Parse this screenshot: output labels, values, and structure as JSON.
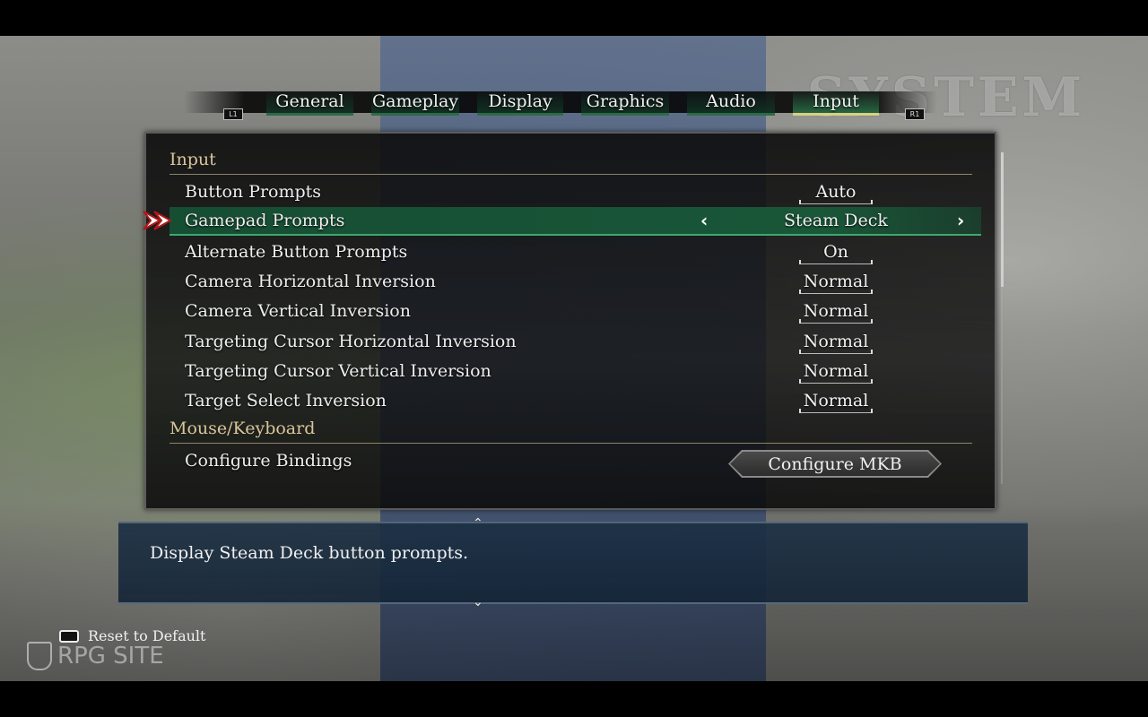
{
  "background": {
    "system_word": "SYSTEM",
    "watermark": "RPG SITE"
  },
  "tabs": [
    {
      "label": "General",
      "active": false
    },
    {
      "label": "Gameplay",
      "active": false
    },
    {
      "label": "Display",
      "active": false
    },
    {
      "label": "Graphics",
      "active": false
    },
    {
      "label": "Audio",
      "active": false
    },
    {
      "label": "Input",
      "active": true
    }
  ],
  "shoulder": {
    "left": "L1",
    "right": "R1"
  },
  "sections": {
    "input": "Input",
    "mouse_keyboard": "Mouse/Keyboard"
  },
  "settings": [
    {
      "label": "Button Prompts",
      "value": "Auto"
    },
    {
      "label": "Gamepad Prompts",
      "value": "Steam Deck",
      "selected": true
    },
    {
      "label": "Alternate Button Prompts",
      "value": "On"
    },
    {
      "label": "Camera Horizontal Inversion",
      "value": "Normal"
    },
    {
      "label": "Camera Vertical Inversion",
      "value": "Normal"
    },
    {
      "label": "Targeting Cursor Horizontal Inversion",
      "value": "Normal"
    },
    {
      "label": "Targeting Cursor Vertical Inversion",
      "value": "Normal"
    },
    {
      "label": "Target Select Inversion",
      "value": "Normal"
    }
  ],
  "bindings": {
    "label": "Configure Bindings",
    "button": "Configure MKB"
  },
  "description": "Display Steam Deck button prompts.",
  "footer": {
    "reset_label": "Reset to Default"
  },
  "colors": {
    "accent_green": "#2d6a48",
    "selected_row": "#195a3a",
    "section_text": "#d8c69a",
    "description_bg": "#1c3044"
  }
}
